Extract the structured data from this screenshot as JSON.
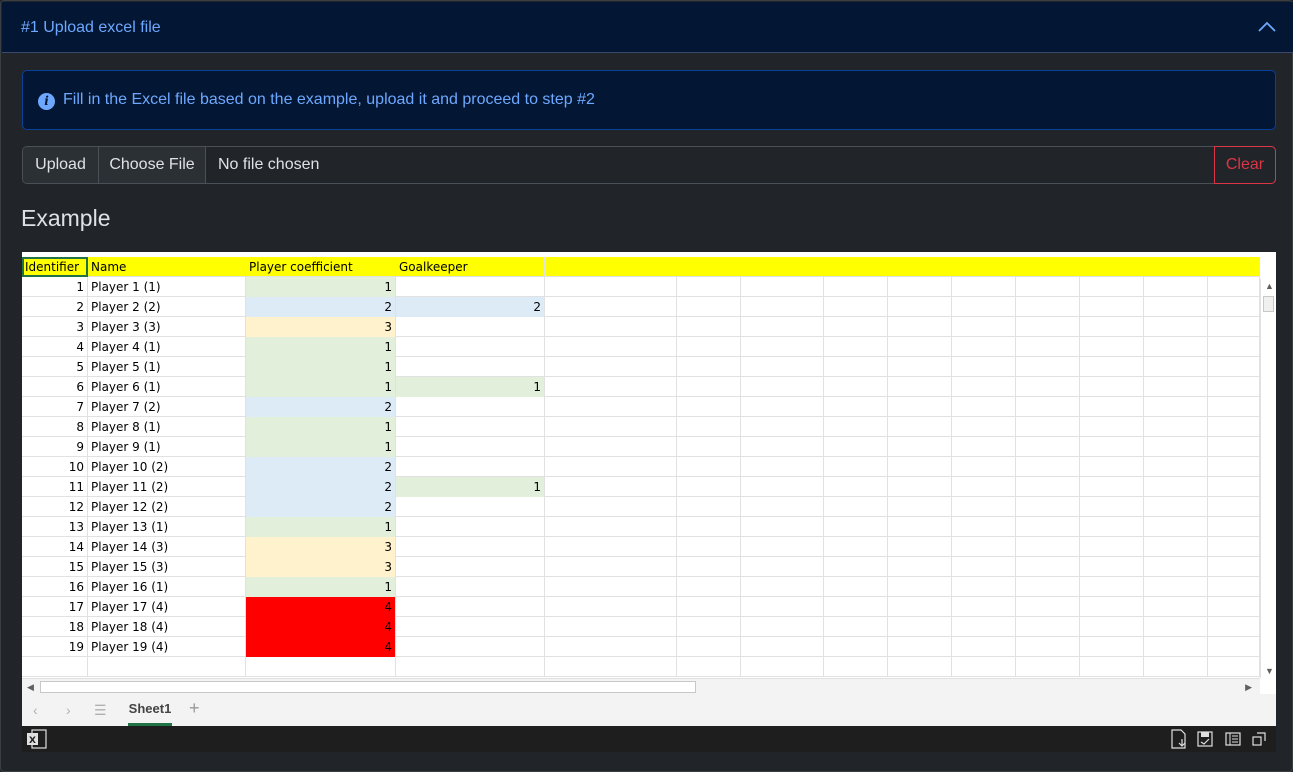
{
  "accordion": {
    "title": "#1 Upload excel file"
  },
  "alert": {
    "text": "Fill in the Excel file based on the example, upload it and proceed to step #2",
    "icon": "info-icon"
  },
  "upload": {
    "upload_label": "Upload",
    "choose_label": "Choose File",
    "status": "No file chosen",
    "clear_label": "Clear"
  },
  "example": {
    "title": "Example"
  },
  "sheet": {
    "headers": [
      "Identifier",
      "Name",
      "Player coefficient",
      "Goalkeeper"
    ],
    "rows": [
      {
        "id": "1",
        "name": "Player 1 (1)",
        "coef": "1",
        "gk": ""
      },
      {
        "id": "2",
        "name": "Player 2 (2)",
        "coef": "2",
        "gk": "2"
      },
      {
        "id": "3",
        "name": "Player 3 (3)",
        "coef": "3",
        "gk": ""
      },
      {
        "id": "4",
        "name": "Player 4 (1)",
        "coef": "1",
        "gk": ""
      },
      {
        "id": "5",
        "name": "Player 5 (1)",
        "coef": "1",
        "gk": ""
      },
      {
        "id": "6",
        "name": "Player 6 (1)",
        "coef": "1",
        "gk": "1"
      },
      {
        "id": "7",
        "name": "Player 7 (2)",
        "coef": "2",
        "gk": ""
      },
      {
        "id": "8",
        "name": "Player 8 (1)",
        "coef": "1",
        "gk": ""
      },
      {
        "id": "9",
        "name": "Player 9 (1)",
        "coef": "1",
        "gk": ""
      },
      {
        "id": "10",
        "name": "Player 10 (2)",
        "coef": "2",
        "gk": ""
      },
      {
        "id": "11",
        "name": "Player 11 (2)",
        "coef": "2",
        "gk": "1"
      },
      {
        "id": "12",
        "name": "Player 12 (2)",
        "coef": "2",
        "gk": ""
      },
      {
        "id": "13",
        "name": "Player 13 (1)",
        "coef": "1",
        "gk": ""
      },
      {
        "id": "14",
        "name": "Player 14 (3)",
        "coef": "3",
        "gk": ""
      },
      {
        "id": "15",
        "name": "Player 15 (3)",
        "coef": "3",
        "gk": ""
      },
      {
        "id": "16",
        "name": "Player 16 (1)",
        "coef": "1",
        "gk": ""
      },
      {
        "id": "17",
        "name": "Player 17 (4)",
        "coef": "4",
        "gk": ""
      },
      {
        "id": "18",
        "name": "Player 18 (4)",
        "coef": "4",
        "gk": ""
      },
      {
        "id": "19",
        "name": "Player 19 (4)",
        "coef": "4",
        "gk": ""
      }
    ],
    "level_colors": {
      "1": "#e2efda",
      "2": "#ddebf7",
      "3": "#fff2cc",
      "4": "#ff0000"
    },
    "header_color": "#ffff00",
    "tab_name": "Sheet1"
  },
  "icons": [
    "chevron-up-icon",
    "info-icon",
    "excel-logo-icon",
    "download-icon",
    "save-icon",
    "reading-view-icon",
    "fullscreen-icon"
  ]
}
